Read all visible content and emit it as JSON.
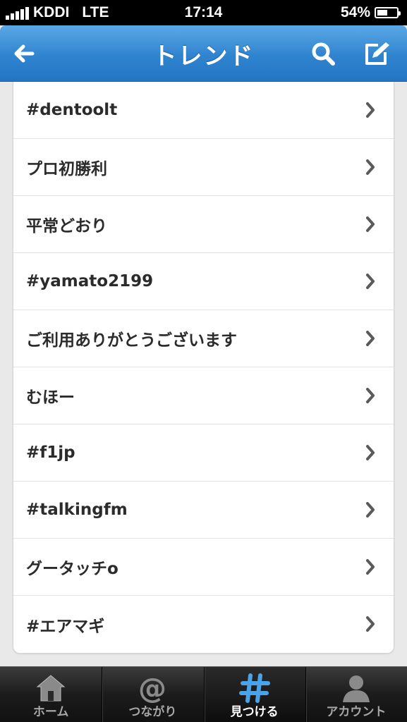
{
  "status": {
    "carrier": "KDDI",
    "network": "LTE",
    "time": "17:14",
    "battery": "54%",
    "battery_level": 0.54
  },
  "nav": {
    "title": "トレンド",
    "back_icon": "arrow-left-icon",
    "search_icon": "search-icon",
    "compose_icon": "compose-icon"
  },
  "trends": [
    {
      "label": "#dentoolt"
    },
    {
      "label": "プロ初勝利"
    },
    {
      "label": "平常どおり"
    },
    {
      "label": "#yamato2199"
    },
    {
      "label": "ご利用ありがとうございます"
    },
    {
      "label": "むほー"
    },
    {
      "label": "#f1jp"
    },
    {
      "label": "#talkingfm"
    },
    {
      "label": "グータッチo"
    },
    {
      "label": "#エアマギ"
    }
  ],
  "tabs": [
    {
      "label": "ホーム",
      "icon": "home-icon",
      "active": false
    },
    {
      "label": "つながり",
      "icon": "at-icon",
      "active": false
    },
    {
      "label": "見つける",
      "icon": "hashtag-icon",
      "active": true
    },
    {
      "label": "アカウント",
      "icon": "profile-icon",
      "active": false
    }
  ],
  "colors": {
    "nav_blue": "#2f84cf",
    "active_tab_icon": "#4aa3e8"
  }
}
